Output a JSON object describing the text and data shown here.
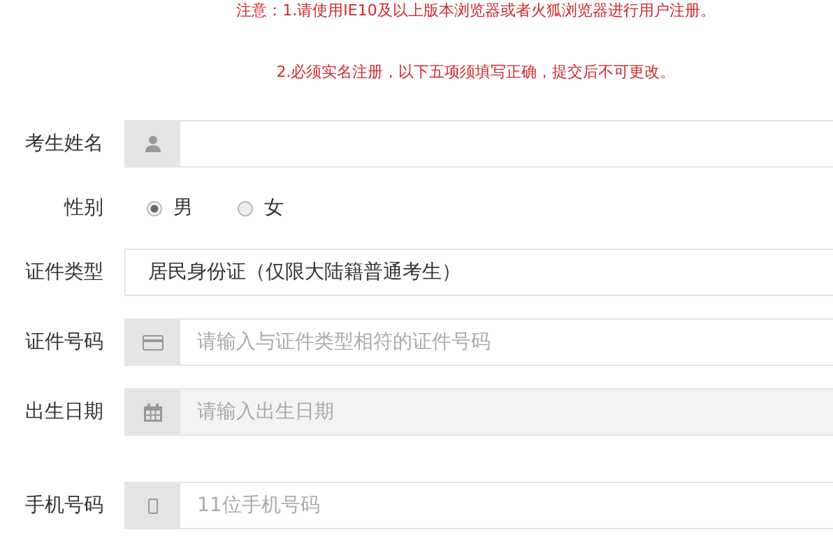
{
  "notices": [
    "注意：1.请使用IE10及以上版本浏览器或者火狐浏览器进行用户注册。",
    "2.必须实名注册，以下五项须填写正确，提交后不可更改。"
  ],
  "fields": [
    {
      "kind": "input",
      "label": "考生姓名",
      "readonly": false
    },
    {
      "kind": "radio",
      "label": "性别",
      "options": [
        {
          "label": "男",
          "selected": true
        },
        {
          "label": "女",
          "selected": false
        }
      ]
    },
    {
      "kind": "select",
      "label": "证件类型",
      "value": "居民身份证（仅限大陆籍普通考生）"
    },
    {
      "kind": "input",
      "label": "证件号码",
      "placeholder": "请输入与证件类型相符的证件号码",
      "readonly": false
    },
    {
      "kind": "input",
      "label": "出生日期",
      "placeholder": "请输入出生日期",
      "readonly": true
    },
    {
      "kind": "input",
      "label": "手机号码",
      "placeholder": "11位手机号码",
      "readonly": false
    }
  ]
}
